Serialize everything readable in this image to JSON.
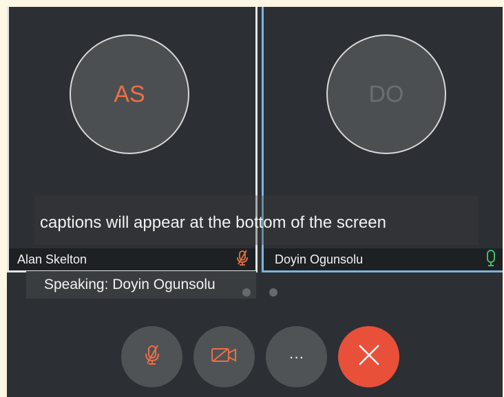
{
  "participants": [
    {
      "initials": "AS",
      "name": "Alan Skelton",
      "mic": "muted-mic-icon"
    },
    {
      "initials": "DO",
      "name": "Doyin Ogunsolu",
      "mic": "active-mic-icon"
    }
  ],
  "caption": {
    "text": "captions will appear at the bottom of the screen"
  },
  "speaking": {
    "text": "Speaking: Doyin Ogunsolu"
  },
  "controls": {
    "mute_icon": "muted-mic-icon",
    "video_icon": "video-off-icon",
    "more_label": "···",
    "end_icon": "end-call-icon"
  },
  "colors": {
    "accent_orange": "#ed6f44",
    "end_call_red": "#e8503a",
    "active_speaker_blue": "#7fb4db",
    "mic_active_green": "#3cc06a"
  }
}
